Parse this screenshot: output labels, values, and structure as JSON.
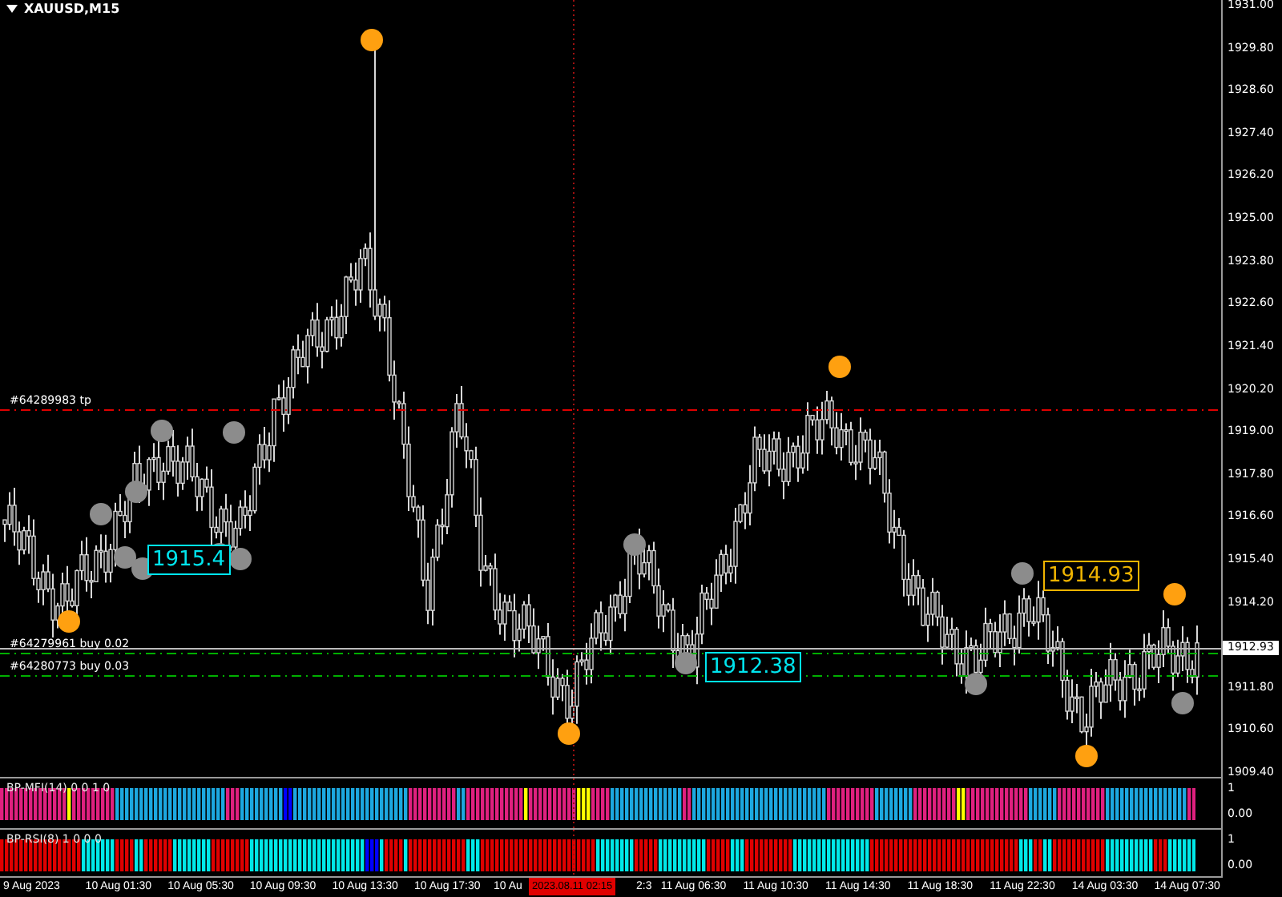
{
  "chart": {
    "title": "XAUUSD,M15",
    "price_axis": [
      "1931.00",
      "1929.80",
      "1928.60",
      "1927.40",
      "1926.20",
      "1925.00",
      "1923.80",
      "1922.60",
      "1921.40",
      "1920.20",
      "1919.00",
      "1917.80",
      "1916.60",
      "1915.40",
      "1914.20",
      "1911.80",
      "1910.60",
      "1909.40"
    ],
    "current_price": "1912.93",
    "orders": [
      {
        "label": "#64289983 tp",
        "kind": "tp"
      },
      {
        "label": "#64279961 buy 0.02",
        "kind": "buy"
      },
      {
        "label": "#64280773 buy 0.03",
        "kind": "buy"
      }
    ],
    "price_labels": [
      {
        "text": "1915.4",
        "color": "#00e5ee"
      },
      {
        "text": "1912.38",
        "color": "#00e5ee"
      },
      {
        "text": "1914.93",
        "color": "#f0b400"
      }
    ]
  },
  "indicators": [
    {
      "label": "BP-MFI(14) 0 0 1 0",
      "axis_max": "1",
      "axis_min": "0.00",
      "kind": "mfi"
    },
    {
      "label": "BP-RSI(8) 1 0 0 0",
      "axis_max": "1",
      "axis_min": "0.00",
      "kind": "rsi"
    }
  ],
  "time_axis": {
    "labels": [
      "9 Aug 2023",
      "10 Aug 01:30",
      "10 Aug 05:30",
      "10 Aug 09:30",
      "10 Aug 13:30",
      "10 Aug 17:30",
      "10 Au",
      "2:3",
      "11 Aug 06:30",
      "11 Aug 10:30",
      "11 Aug 14:30",
      "11 Aug 18:30",
      "11 Aug 22:30",
      "14 Aug 03:30",
      "14 Aug 07:30"
    ],
    "cursor_time": "2023.08.11 02:15"
  }
}
